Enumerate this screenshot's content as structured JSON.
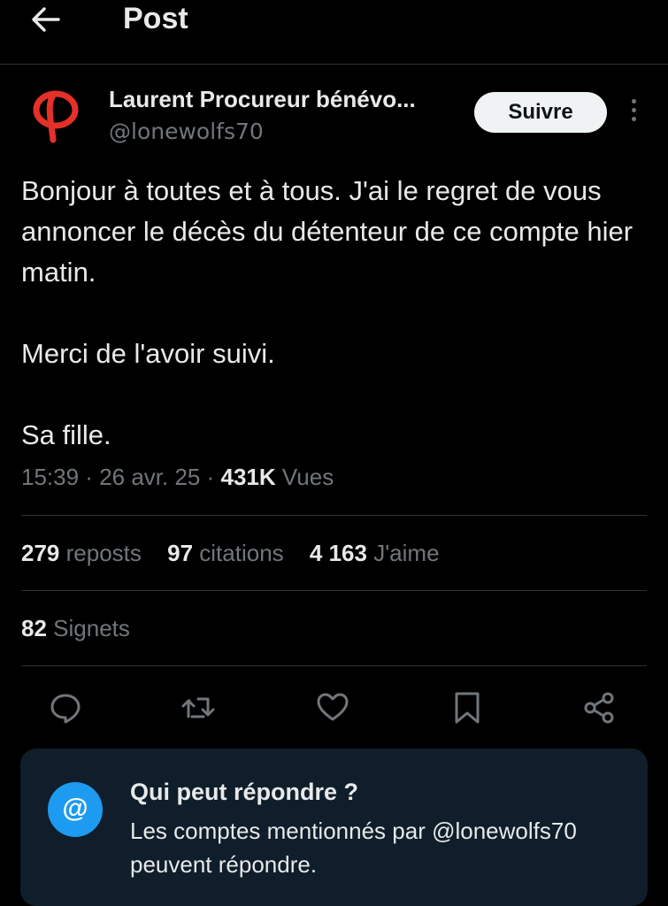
{
  "header": {
    "title": "Post"
  },
  "author": {
    "name": "Laurent Procureur bénévo...",
    "handle": "@lonewolfs70",
    "follow_label": "Suivre"
  },
  "post": {
    "paragraphs": [
      "Bonjour à toutes et à tous. J'ai le regret de vous annoncer le décès du détenteur de ce compte hier matin.",
      "Merci de l'avoir suivi.",
      "Sa fille."
    ]
  },
  "meta": {
    "time": "15:39",
    "date": "26 avr. 25",
    "views_count": "431K",
    "views_label": "Vues"
  },
  "stats": {
    "reposts_count": "279",
    "reposts_label": "reposts",
    "quotes_count": "97",
    "quotes_label": "citations",
    "likes_count": "4 163",
    "likes_label": "J'aime",
    "bookmarks_count": "82",
    "bookmarks_label": "Signets"
  },
  "reply_settings": {
    "icon_glyph": "@",
    "title": "Qui peut répondre ?",
    "description": "Les comptes mentionnés par @lonewolfs70 peuvent répondre."
  },
  "colors": {
    "background": "#000000",
    "text": "#e7e9ea",
    "muted": "#71767b",
    "accent": "#1d9bf0",
    "brand_red": "#e5302a",
    "reply_box": "#0f1e2a"
  },
  "icons": [
    "back-arrow-icon",
    "more-options-icon",
    "reply-icon",
    "repost-icon",
    "like-icon",
    "bookmark-icon",
    "share-icon",
    "at-sign-icon"
  ]
}
